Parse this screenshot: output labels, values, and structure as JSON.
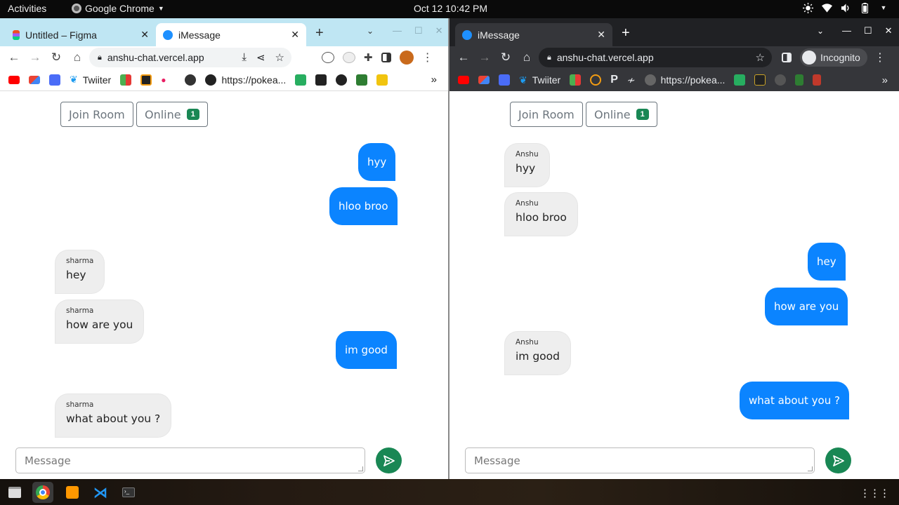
{
  "topbar": {
    "activities": "Activities",
    "app_name": "Google Chrome",
    "clock": "Oct 12  10:42 PM"
  },
  "left_window": {
    "tabs": [
      {
        "title": "Untitled – Figma",
        "favicon": "figma-icon"
      },
      {
        "title": "iMessage",
        "favicon": "imessage-icon"
      }
    ],
    "url": "anshu-chat.vercel.app",
    "bookmarks": [
      {
        "label": "Twiiter"
      },
      {
        "label": "https://pokea..."
      }
    ],
    "app": {
      "join_room": "Join Room",
      "online_label": "Online",
      "online_count": "1",
      "messages": [
        {
          "dir": "out",
          "text": "hyy"
        },
        {
          "dir": "out",
          "text": "hloo broo"
        },
        {
          "dir": "in",
          "sender": "sharma",
          "text": "hey"
        },
        {
          "dir": "in",
          "sender": "sharma",
          "text": "how are you"
        },
        {
          "dir": "out",
          "text": "im good"
        },
        {
          "dir": "in",
          "sender": "sharma",
          "text": "what about you ?"
        }
      ],
      "composer_placeholder": "Message"
    }
  },
  "right_window": {
    "tabs": [
      {
        "title": "iMessage",
        "favicon": "imessage-icon"
      }
    ],
    "url": "anshu-chat.vercel.app",
    "incognito_label": "Incognito",
    "bookmarks": [
      {
        "label": "Twiiter"
      },
      {
        "label": "https://pokea..."
      }
    ],
    "app": {
      "join_room": "Join Room",
      "online_label": "Online",
      "online_count": "1",
      "messages": [
        {
          "dir": "in",
          "sender": "Anshu",
          "text": "hyy"
        },
        {
          "dir": "in",
          "sender": "Anshu",
          "text": "hloo broo"
        },
        {
          "dir": "out",
          "text": "hey"
        },
        {
          "dir": "out",
          "text": "how are you"
        },
        {
          "dir": "in",
          "sender": "Anshu",
          "text": "im good"
        },
        {
          "dir": "out",
          "text": "what about you ?"
        }
      ],
      "composer_placeholder": "Message"
    }
  },
  "colors": {
    "sent_bubble": "#0b84ff",
    "received_bubble": "#eeeeee",
    "badge": "#198754",
    "send_button": "#198754"
  }
}
